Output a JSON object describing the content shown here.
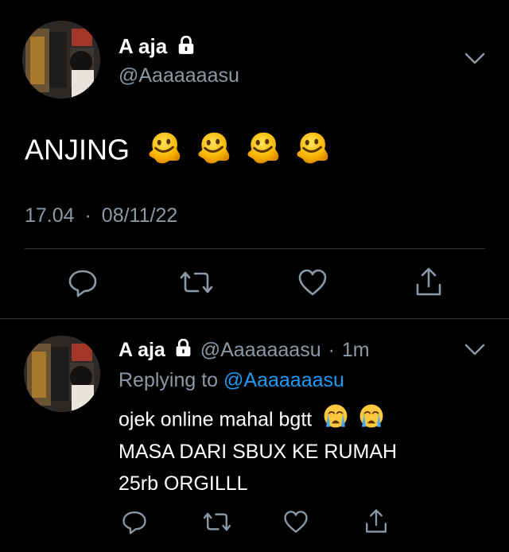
{
  "main_tweet": {
    "display_name": "A aja",
    "handle": "@Aaaaaaasu",
    "text": "ANJING",
    "emojis": [
      "melting-face",
      "melting-face",
      "melting-face",
      "melting-face"
    ],
    "time": "17.04",
    "separator": "·",
    "date": "08/11/22"
  },
  "reply": {
    "display_name": "A aja",
    "handle": "@Aaaaaaasu",
    "separator": "·",
    "age": "1m",
    "replying_prefix": "Replying to",
    "replying_handle": "@Aaaaaaasu",
    "line1": "ojek online mahal bgtt",
    "line1_emojis": [
      "loudly-crying-face",
      "loudly-crying-face"
    ],
    "line2": "MASA DARI SBUX KE RUMAH",
    "line3": "25rb ORGILLL"
  },
  "actions": [
    "reply-icon",
    "retweet-icon",
    "like-icon",
    "share-icon"
  ],
  "colors": {
    "background": "#000000",
    "muted": "#8b98a5",
    "link": "#1d9bf0",
    "divider": "#2f3336"
  }
}
